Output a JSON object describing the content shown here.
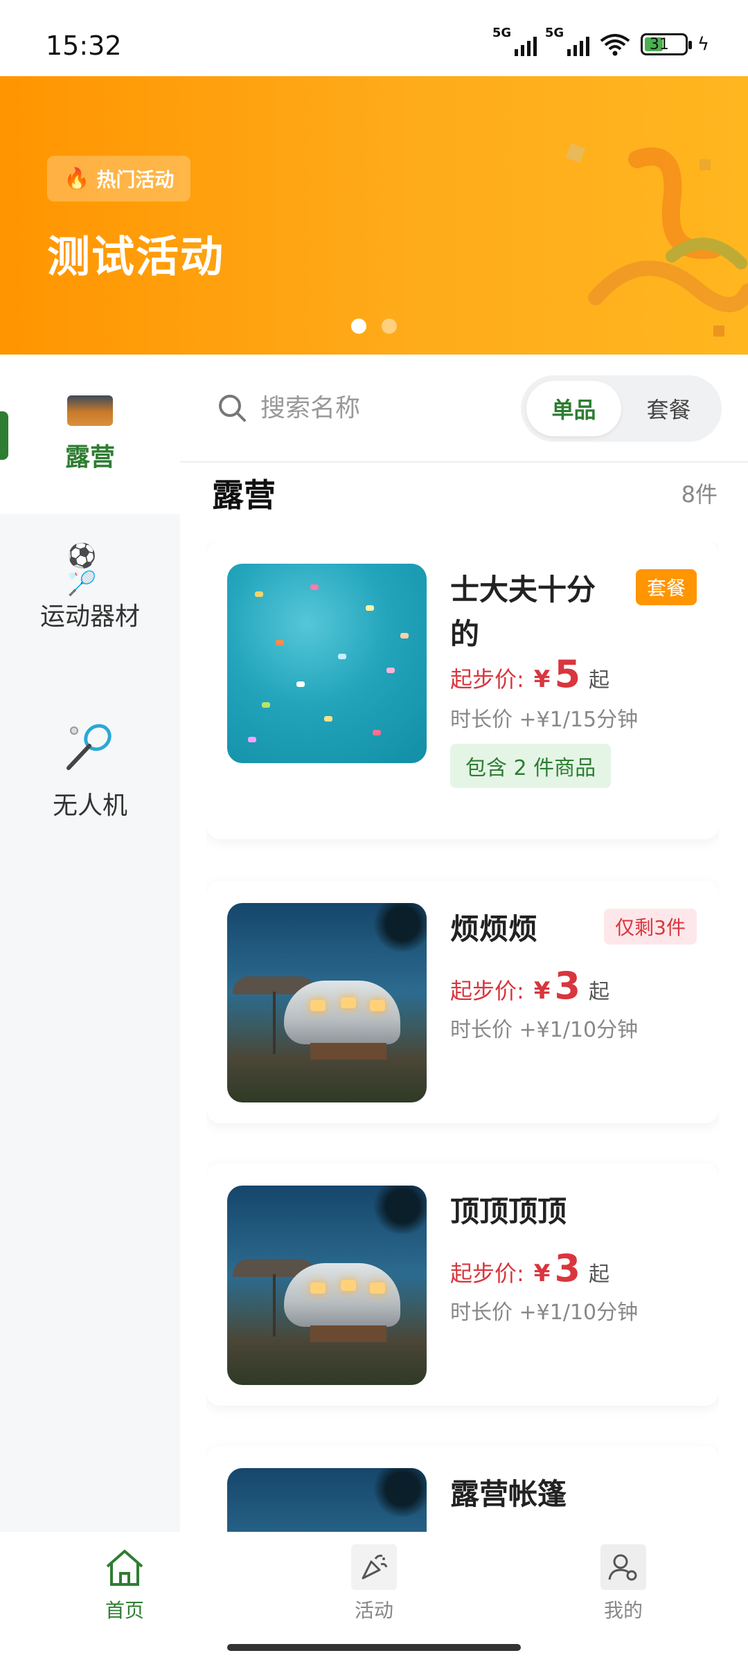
{
  "status_bar": {
    "time": "15:32",
    "signal1": "5G",
    "signal2": "5G",
    "battery": "31"
  },
  "banner": {
    "tag": "热门活动",
    "title": "测试活动",
    "slides": 2,
    "active_slide": 1
  },
  "sidebar": {
    "items": [
      {
        "label": "露营",
        "active": true
      },
      {
        "label": "运动器材",
        "active": false
      },
      {
        "label": "无人机",
        "active": false
      }
    ]
  },
  "search": {
    "placeholder": "搜索名称",
    "value": ""
  },
  "toggle": {
    "options": [
      "单品",
      "套餐"
    ],
    "selected": "单品"
  },
  "section": {
    "title": "露营",
    "count": "8件"
  },
  "products": [
    {
      "name": "士大夫十分的",
      "badge": "套餐",
      "price_label": "起步价:",
      "currency": "¥",
      "price": "5",
      "price_suffix": "起",
      "duration": "时长价 +¥1/15分钟",
      "include": "包含 2 件商品",
      "image": "confetti"
    },
    {
      "name": "烦烦烦",
      "badge": "仅剩3件",
      "price_label": "起步价:",
      "currency": "¥",
      "price": "3",
      "price_suffix": "起",
      "duration": "时长价 +¥1/10分钟",
      "image": "trailer"
    },
    {
      "name": "顶顶顶顶",
      "price_label": "起步价:",
      "currency": "¥",
      "price": "3",
      "price_suffix": "起",
      "duration": "时长价 +¥1/10分钟",
      "image": "trailer"
    },
    {
      "name": "露营帐篷",
      "image": "trailer"
    }
  ],
  "tabbar": {
    "items": [
      {
        "label": "首页",
        "icon": "home-icon",
        "active": true
      },
      {
        "label": "活动",
        "icon": "party-popper-icon",
        "active": false
      },
      {
        "label": "我的",
        "icon": "user-settings-icon",
        "active": false
      }
    ]
  },
  "colors": {
    "brand_green": "#2e7d32",
    "banner_orange": "#ff9500",
    "price_red": "#d9363e"
  }
}
